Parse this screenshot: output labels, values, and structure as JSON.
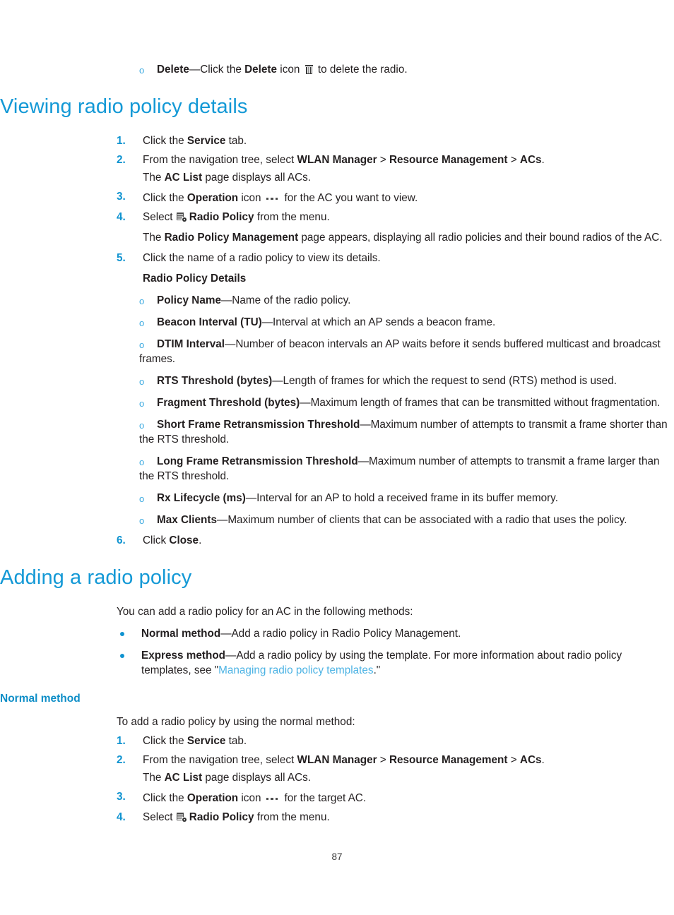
{
  "document": {
    "page_number": "87",
    "colors": {
      "heading": "#1499d6",
      "subheading": "#0e8ec7",
      "number": "#0f93d0",
      "bullet": "#0f93d0",
      "sub_bullet": "#3aa9e0",
      "link": "#4cb3e4",
      "body_text": "#231f20"
    }
  },
  "top_bullet": {
    "marker": "o",
    "term": "Delete",
    "dash": "—",
    "text_before_icon": "Click the ",
    "bold_inline": "Delete",
    "text_mid": " icon ",
    "icon": "trash-icon",
    "text_after": " to delete the radio."
  },
  "section_view": {
    "heading": "Viewing radio policy details",
    "steps": [
      {
        "num": "1.",
        "parts": [
          {
            "t": "Click the ",
            "b": false
          },
          {
            "t": "Service",
            "b": true
          },
          {
            "t": " tab.",
            "b": false
          }
        ]
      },
      {
        "num": "2.",
        "parts": [
          {
            "t": "From the navigation tree, select ",
            "b": false
          },
          {
            "t": "WLAN Manager",
            "b": true
          },
          {
            "t": " > ",
            "b": false
          },
          {
            "t": "Resource Management",
            "b": true
          },
          {
            "t": " > ",
            "b": false
          },
          {
            "t": "ACs",
            "b": true
          },
          {
            "t": ".",
            "b": false
          }
        ],
        "continuation": [
          {
            "t": "The ",
            "b": false
          },
          {
            "t": "AC List",
            "b": true
          },
          {
            "t": " page displays all ACs.",
            "b": false
          }
        ]
      },
      {
        "num": "3.",
        "parts": [
          {
            "t": "Click the ",
            "b": false
          },
          {
            "t": "Operation",
            "b": true
          },
          {
            "t": " icon ",
            "b": false
          },
          {
            "icon": "ellipsis-icon"
          },
          {
            "t": " for the AC you want to view.",
            "b": false
          }
        ]
      },
      {
        "num": "4.",
        "parts": [
          {
            "t": "Select ",
            "b": false
          },
          {
            "icon": "radio-policy-icon"
          },
          {
            "t": "Radio Policy",
            "b": true
          },
          {
            "t": " from the menu.",
            "b": false
          }
        ],
        "continuation": [
          {
            "t": "The ",
            "b": false
          },
          {
            "t": "Radio Policy Management",
            "b": true
          },
          {
            "t": " page appears, displaying all radio policies and their bound radios of the AC.",
            "b": false
          }
        ]
      },
      {
        "num": "5.",
        "parts": [
          {
            "t": "Click the name of a radio policy to view its details.",
            "b": false
          }
        ],
        "sub_heading": "Radio Policy Details",
        "sub_bullets": [
          {
            "marker": "o",
            "term": "Policy Name",
            "dash": "—",
            "desc": "Name of the radio policy."
          },
          {
            "marker": "o",
            "term": "Beacon Interval (TU)",
            "dash": "—",
            "desc": "Interval at which an AP sends a beacon frame."
          },
          {
            "marker": "o",
            "term": "DTIM Interval",
            "dash": "—",
            "desc": "Number of beacon intervals an AP waits before it sends buffered multicast and broadcast frames."
          },
          {
            "marker": "o",
            "term": "RTS Threshold (bytes)",
            "dash": "—",
            "desc": "Length of frames for which the request to send (RTS) method is used."
          },
          {
            "marker": "o",
            "term": "Fragment Threshold (bytes)",
            "dash": "—",
            "desc": "Maximum length of frames that can be transmitted without fragmentation."
          },
          {
            "marker": "o",
            "term": "Short Frame Retransmission Threshold",
            "dash": "—",
            "desc": "Maximum number of attempts to transmit a frame shorter than the RTS threshold."
          },
          {
            "marker": "o",
            "term": "Long Frame Retransmission Threshold",
            "dash": "—",
            "desc": "Maximum number of attempts to transmit a frame larger than the RTS threshold."
          },
          {
            "marker": "o",
            "term": "Rx Lifecycle (ms)",
            "dash": "—",
            "desc": "Interval for an AP to hold a received frame in its buffer memory."
          },
          {
            "marker": "o",
            "term": "Max Clients",
            "dash": "—",
            "desc": "Maximum number of clients that can be associated with a radio that uses the policy."
          }
        ]
      },
      {
        "num": "6.",
        "parts": [
          {
            "t": "Click ",
            "b": false
          },
          {
            "t": "Close",
            "b": true
          },
          {
            "t": ".",
            "b": false
          }
        ]
      }
    ]
  },
  "section_add": {
    "heading": "Adding a radio policy",
    "intro": "You can add a radio policy for an AC in the following methods:",
    "methods": [
      {
        "term": "Normal method",
        "dash": "—",
        "desc": "Add a radio policy in Radio Policy Management."
      },
      {
        "term": "Express method",
        "dash": "—",
        "desc_before_link": "Add a radio policy by using the template. For more information about radio policy templates, see \"",
        "link": "Managing radio policy templates",
        "desc_after_link": ".\""
      }
    ],
    "subsection": {
      "heading": "Normal method",
      "intro": "To add a radio policy by using the normal method:",
      "steps": [
        {
          "num": "1.",
          "parts": [
            {
              "t": "Click the ",
              "b": false
            },
            {
              "t": "Service",
              "b": true
            },
            {
              "t": " tab.",
              "b": false
            }
          ]
        },
        {
          "num": "2.",
          "parts": [
            {
              "t": "From the navigation tree, select ",
              "b": false
            },
            {
              "t": "WLAN Manager",
              "b": true
            },
            {
              "t": " > ",
              "b": false
            },
            {
              "t": "Resource Management",
              "b": true
            },
            {
              "t": " > ",
              "b": false
            },
            {
              "t": "ACs",
              "b": true
            },
            {
              "t": ".",
              "b": false
            }
          ],
          "continuation": [
            {
              "t": "The ",
              "b": false
            },
            {
              "t": "AC List",
              "b": true
            },
            {
              "t": " page displays all ACs.",
              "b": false
            }
          ]
        },
        {
          "num": "3.",
          "parts": [
            {
              "t": "Click the ",
              "b": false
            },
            {
              "t": "Operation",
              "b": true
            },
            {
              "t": " icon ",
              "b": false
            },
            {
              "icon": "ellipsis-icon"
            },
            {
              "t": " for the target AC.",
              "b": false
            }
          ]
        },
        {
          "num": "4.",
          "parts": [
            {
              "t": "Select ",
              "b": false
            },
            {
              "icon": "radio-policy-icon"
            },
            {
              "t": "Radio Policy",
              "b": true
            },
            {
              "t": " from the menu.",
              "b": false
            }
          ]
        }
      ]
    }
  }
}
